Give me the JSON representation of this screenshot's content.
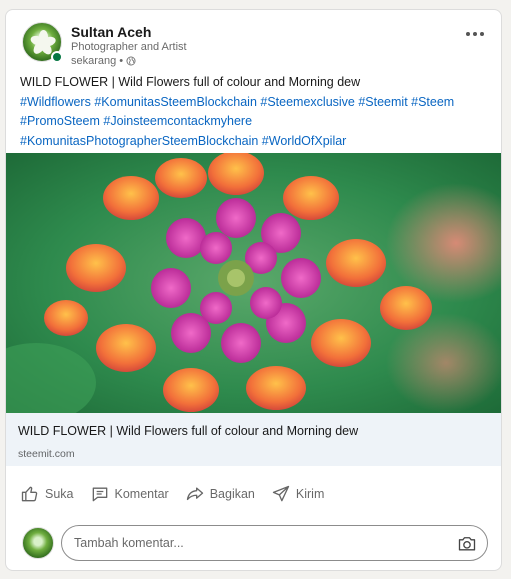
{
  "post": {
    "author_name": "Sultan Aceh",
    "author_headline": "Photographer and Artist",
    "timestamp": "sekarang",
    "separator": "•",
    "text_line": "WILD FLOWER | Wild Flowers full of colour and Morning dew",
    "hashtags_line1": "#Wildflowers #KomunitasSteemBlockchain #Steemexclusive #Steemit #Steem",
    "hashtags_line2": "#PromoSteem #Joinsteemcontackmyhere",
    "hashtags_line3": "#KomunitasPhotographerSteemBlockchain #WorldOfXpilar"
  },
  "link_preview": {
    "title": "WILD FLOWER | Wild Flowers full of colour and Morning dew",
    "domain": "steemit.com"
  },
  "actions": {
    "like": "Suka",
    "comment": "Komentar",
    "share": "Bagikan",
    "send": "Kirim"
  },
  "comment_box": {
    "placeholder": "Tambah komentar..."
  },
  "icons": [
    "more-icon",
    "globe-icon",
    "like-icon",
    "comment-icon",
    "share-icon",
    "send-icon",
    "camera-icon"
  ],
  "colors": {
    "hashtag": "#0a66c2",
    "online": "#057642",
    "link_bg": "#eef3f8"
  }
}
